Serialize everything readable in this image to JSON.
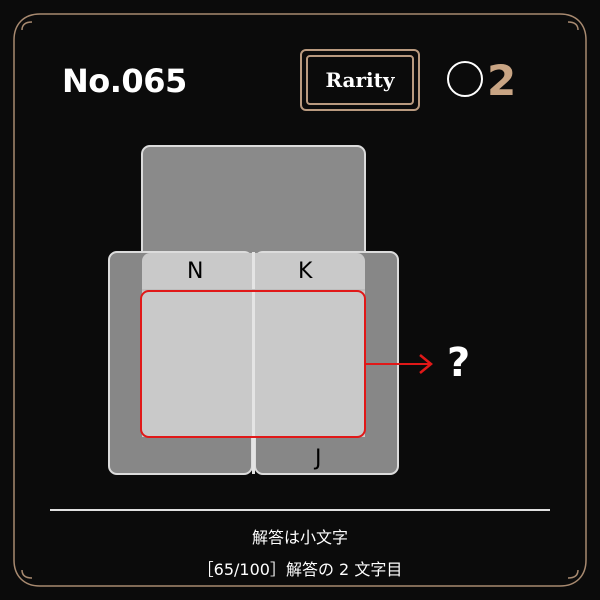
{
  "header": {
    "puzzle_number": "No.065",
    "rarity_label": "Rarity",
    "rarity_value": "2"
  },
  "puzzle": {
    "card_letters": {
      "left": "N",
      "right": "K",
      "bottom": "J"
    },
    "answer_mark": "?"
  },
  "footer": {
    "hint": "解答は小文字",
    "progress": "［65/100］解答の 2 文字目"
  },
  "colors": {
    "background": "#0b0b0b",
    "accent_gold": "#c9a584",
    "frame_gold": "#b99a7f",
    "highlight_red": "#e01818"
  }
}
